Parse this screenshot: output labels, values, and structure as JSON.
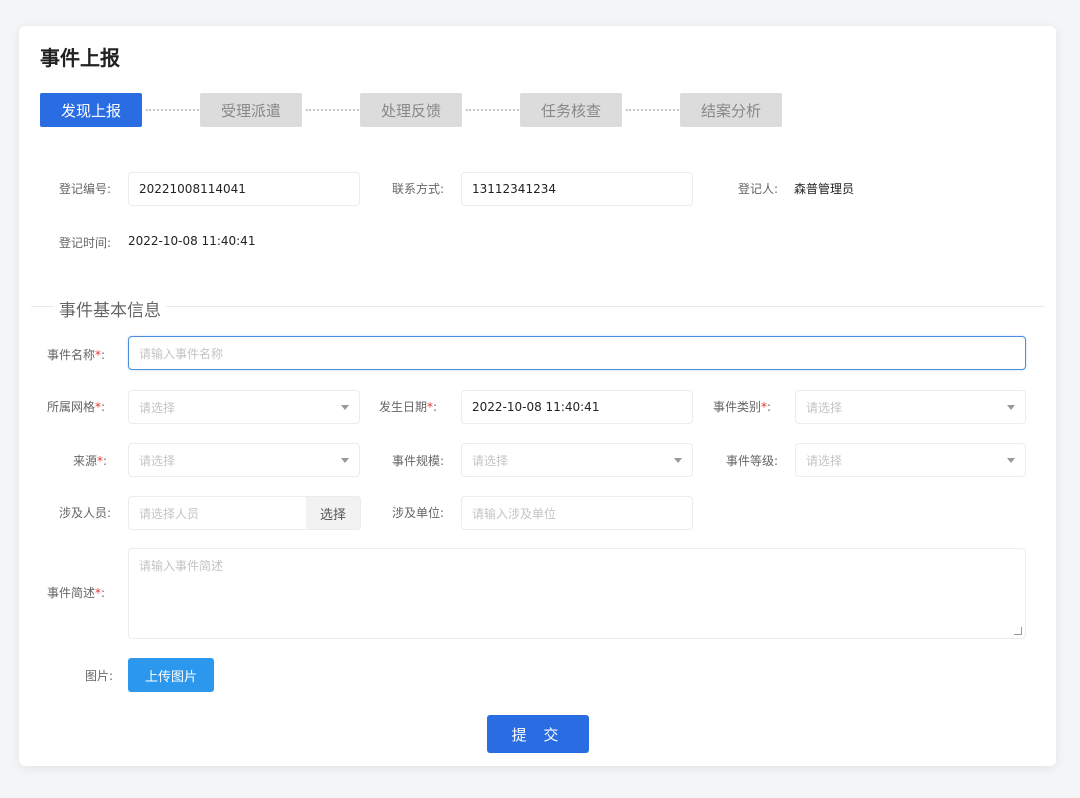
{
  "page": {
    "title": "事件上报"
  },
  "steps": [
    {
      "label": "发现上报",
      "active": true
    },
    {
      "label": "受理派遣",
      "active": false
    },
    {
      "label": "处理反馈",
      "active": false
    },
    {
      "label": "任务核查",
      "active": false
    },
    {
      "label": "结案分析",
      "active": false
    }
  ],
  "register": {
    "number_label": "登记编号:",
    "number_value": "20221008114041",
    "contact_label": "联系方式:",
    "contact_value": "13112341234",
    "person_label": "登记人:",
    "person_value": "森普管理员",
    "time_label": "登记时间:",
    "time_value": "2022-10-08 11:40:41"
  },
  "section": {
    "title": "事件基本信息"
  },
  "form": {
    "event_name_label": "事件名称",
    "event_name_placeholder": "请输入事件名称",
    "grid_label": "所属网格",
    "grid_placeholder": "请选择",
    "date_label": "发生日期",
    "date_value": "2022-10-08 11:40:41",
    "category_label": "事件类别",
    "category_placeholder": "请选择",
    "source_label": "来源",
    "source_placeholder": "请选择",
    "scale_label": "事件规模:",
    "scale_placeholder": "请选择",
    "level_label": "事件等级:",
    "level_placeholder": "请选择",
    "people_label": "涉及人员:",
    "people_placeholder": "请选择人员",
    "people_button": "选择",
    "unit_label": "涉及单位:",
    "unit_placeholder": "请输入涉及单位",
    "desc_label": "事件简述",
    "desc_placeholder": "请输入事件简述",
    "image_label": "图片:",
    "upload_button": "上传图片",
    "required_mark": "*",
    "colon": ":"
  },
  "submit_button": "提 交",
  "colors": {
    "primary": "#2a6de3",
    "upload": "#2b98ee",
    "inactive_step": "#dcdcdc",
    "required": "#e53935"
  }
}
